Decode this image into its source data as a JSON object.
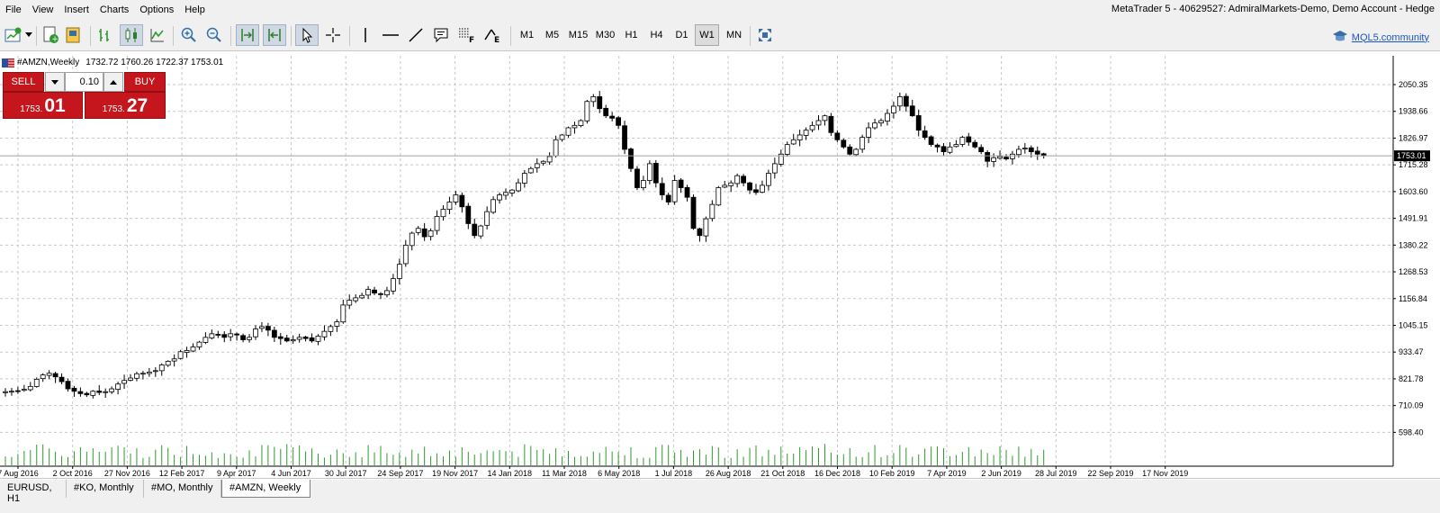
{
  "window": {
    "title": "MetaTrader 5 - 40629527: AdmiralMarkets-Demo, Demo Account - Hedge"
  },
  "menu": [
    "File",
    "View",
    "Insert",
    "Charts",
    "Options",
    "Help"
  ],
  "toolbar": {
    "timeframes": [
      "M1",
      "M5",
      "M15",
      "M30",
      "H1",
      "H4",
      "D1",
      "W1",
      "MN"
    ],
    "active_timeframe": "W1",
    "community_label": "MQL5.community",
    "icons": [
      "new-chart-icon",
      "dropdown-arrow-icon",
      "new-order-icon",
      "algo-trading-icon",
      "bar-chart-icon",
      "candlestick-icon",
      "line-chart-icon",
      "zoom-in-icon",
      "zoom-out-icon",
      "autoscroll-icon",
      "chart-shift-icon",
      "cursor-icon",
      "crosshair-icon",
      "vertical-line-icon",
      "horizontal-line-icon",
      "trendline-icon",
      "text-icon",
      "fibonacci-icon",
      "objects-icon",
      "fullscreen-icon",
      "mql5-hat-icon"
    ]
  },
  "chart_header": {
    "symbol": "#AMZN,Weekly",
    "ohlc": "1732.72 1760.26 1722.37 1753.01"
  },
  "trade_panel": {
    "sell_label": "SELL",
    "buy_label": "BUY",
    "lot": "0.10",
    "sell_price_small": "1753.",
    "sell_price_big": "01",
    "buy_price_small": "1753.",
    "buy_price_big": "27",
    "colors": {
      "panel": "#c4161c"
    }
  },
  "tabs": [
    {
      "label": "EURUSD, H1",
      "active": false
    },
    {
      "label": "#KO, Monthly",
      "active": false
    },
    {
      "label": "#MO, Monthly",
      "active": false
    },
    {
      "label": "#AMZN, Weekly",
      "active": true
    }
  ],
  "chart_data": {
    "type": "candlestick",
    "symbol": "#AMZN",
    "timeframe": "Weekly",
    "ylim": [
      598.4,
      2110
    ],
    "y_ticks": [
      "2050.35",
      "1938.66",
      "1826.97",
      "1715.28",
      "1603.60",
      "1491.91",
      "1380.22",
      "1268.53",
      "1156.84",
      "1045.15",
      "933.47",
      "821.78",
      "710.09",
      "598.40"
    ],
    "x_ticks": [
      "7 Aug 2016",
      "2 Oct 2016",
      "27 Nov 2016",
      "12 Feb 2017",
      "9 Apr 2017",
      "4 Jun 2017",
      "30 Jul 2017",
      "24 Sep 2017",
      "19 Nov 2017",
      "14 Jan 2018",
      "11 Mar 2018",
      "6 May 2018",
      "1 Jul 2018",
      "26 Aug 2018",
      "21 Oct 2018",
      "16 Dec 2018",
      "10 Feb 2019",
      "7 Apr 2019",
      "2 Jun 2019",
      "28 Jul 2019",
      "22 Sep 2019",
      "17 Nov 2019"
    ],
    "current_price": "1753.01",
    "grid": true,
    "colors": {
      "bull": "#ffffff",
      "bear": "#000000",
      "volume": "#2e9a2e",
      "grid": "#c8c8c8"
    },
    "closes": [
      768,
      770,
      772,
      778,
      790,
      820,
      838,
      845,
      830,
      810,
      780,
      770,
      760,
      755,
      770,
      765,
      768,
      780,
      800,
      815,
      825,
      843,
      845,
      850,
      856,
      880,
      895,
      905,
      935,
      940,
      955,
      975,
      995,
      1010,
      1005,
      995,
      1010,
      1005,
      985,
      995,
      1030,
      1040,
      1025,
      995,
      990,
      980,
      985,
      995,
      990,
      980,
      1000,
      1020,
      1040,
      1060,
      1130,
      1150,
      1160,
      1170,
      1195,
      1180,
      1175,
      1190,
      1240,
      1300,
      1380,
      1430,
      1450,
      1415,
      1440,
      1500,
      1530,
      1560,
      1590,
      1540,
      1470,
      1420,
      1460,
      1520,
      1570,
      1590,
      1600,
      1610,
      1640,
      1680,
      1700,
      1720,
      1730,
      1750,
      1820,
      1840,
      1870,
      1880,
      1900,
      1980,
      2000,
      1950,
      1920,
      1910,
      1880,
      1780,
      1700,
      1620,
      1650,
      1720,
      1640,
      1590,
      1560,
      1650,
      1620,
      1580,
      1450,
      1420,
      1490,
      1550,
      1620,
      1630,
      1640,
      1670,
      1640,
      1610,
      1600,
      1630,
      1680,
      1720,
      1760,
      1800,
      1820,
      1840,
      1860,
      1880,
      1900,
      1920,
      1850,
      1820,
      1790,
      1760,
      1780,
      1830,
      1870,
      1890,
      1900,
      1930,
      1960,
      2000,
      1960,
      1920,
      1860,
      1830,
      1800,
      1790,
      1770,
      1790,
      1800,
      1830,
      1810,
      1790,
      1770,
      1730,
      1745,
      1750,
      1740,
      1760,
      1780,
      1785,
      1770,
      1760,
      1753
    ]
  }
}
